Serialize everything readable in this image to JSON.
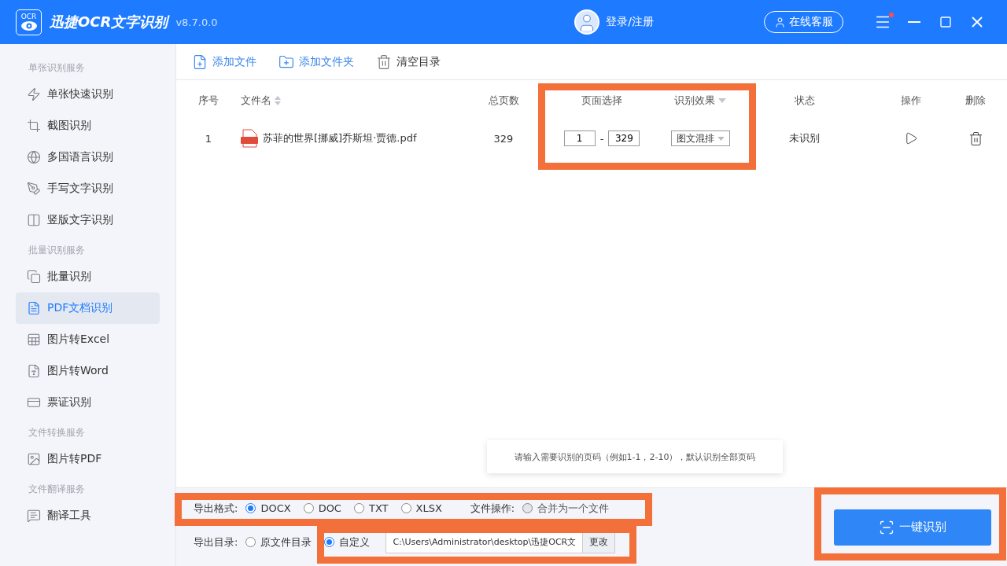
{
  "app": {
    "title": "迅捷OCR文字识别",
    "logo_text": "OCR",
    "version": "v8.7.0.0",
    "login": "登录/注册",
    "support": "在线客服",
    "notification": true
  },
  "sidebar": {
    "sections": [
      {
        "title": "单张识别服务",
        "items": [
          {
            "label": "单张快速识别",
            "kind": "quick",
            "selected": false
          },
          {
            "label": "截图识别",
            "kind": "crop",
            "selected": false
          },
          {
            "label": "多国语言识别",
            "kind": "globe",
            "selected": false
          },
          {
            "label": "手写文字识别",
            "kind": "pen",
            "selected": false
          },
          {
            "label": "竖版文字识别",
            "kind": "vertical",
            "selected": false
          }
        ]
      },
      {
        "title": "批量识别服务",
        "items": [
          {
            "label": "批量识别",
            "kind": "batch",
            "selected": false
          },
          {
            "label": "PDF文档识别",
            "kind": "pdf",
            "selected": true
          },
          {
            "label": "图片转Excel",
            "kind": "excel",
            "selected": false
          },
          {
            "label": "图片转Word",
            "kind": "word",
            "selected": false
          },
          {
            "label": "票证识别",
            "kind": "card",
            "selected": false
          }
        ]
      },
      {
        "title": "文件转换服务",
        "items": [
          {
            "label": "图片转PDF",
            "kind": "topdf",
            "selected": false
          }
        ]
      },
      {
        "title": "文件翻译服务",
        "items": [
          {
            "label": "翻译工具",
            "kind": "translate",
            "selected": false
          }
        ]
      }
    ]
  },
  "toolbar": [
    {
      "label": "添加文件",
      "kind": "add-file"
    },
    {
      "label": "添加文件夹",
      "kind": "add-folder"
    },
    {
      "label": "清空目录",
      "kind": "clear"
    }
  ],
  "table": {
    "columns": [
      {
        "label": "序号",
        "kind": "plain"
      },
      {
        "label": "文件名",
        "kind": "sortable"
      },
      {
        "label": "总页数",
        "kind": "plain"
      },
      {
        "label": "页面选择",
        "kind": "plain"
      },
      {
        "label": "识别效果",
        "kind": "dropdown"
      },
      {
        "label": "状态",
        "kind": "plain"
      },
      {
        "label": "操作",
        "kind": "plain"
      },
      {
        "label": "删除",
        "kind": "plain"
      }
    ],
    "rows": [
      {
        "index": "1",
        "name": "苏菲的世界[挪威]乔斯坦·贾德.pdf",
        "pages": "329",
        "page_from": "1",
        "page_to": "329",
        "separator": "-",
        "mode": "图文混排",
        "status": "未识别"
      }
    ]
  },
  "hint": "请输入需要识别的页码（例如1-1，2-10），默认识别全部页码",
  "export": {
    "format_label": "导出格式:",
    "formats": [
      {
        "label": "DOCX",
        "selected": true
      },
      {
        "label": "DOC",
        "selected": false
      },
      {
        "label": "TXT",
        "selected": false
      },
      {
        "label": "XLSX",
        "selected": false
      }
    ],
    "file_op_label": "文件操作:",
    "merge": {
      "label": "合并为一个文件",
      "checked": false,
      "disabled": true
    },
    "dir_label": "导出目录:",
    "dirs": [
      {
        "label": "原文件目录",
        "selected": false
      },
      {
        "label": "自定义",
        "selected": true
      }
    ],
    "path": "C:\\Users\\Administrator\\desktop\\迅捷OCR文",
    "change": "更改",
    "start": "一键识别"
  }
}
